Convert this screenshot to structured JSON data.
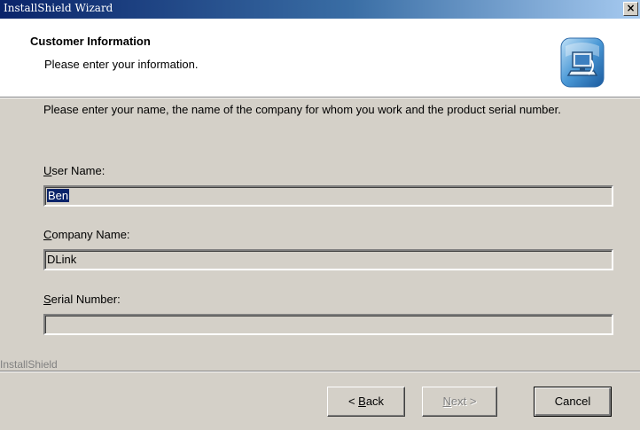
{
  "window": {
    "title": "InstallShield Wizard",
    "close_glyph": "×"
  },
  "header": {
    "title": "Customer Information",
    "subtitle": "Please enter your information.",
    "icon": "installshield-computer-icon"
  },
  "intro": "Please enter your name, the name of the company for whom you work and the product serial number.",
  "fields": {
    "user_name": {
      "label_accel": "U",
      "label_rest": "ser Name:",
      "value": "Ben",
      "selected": true
    },
    "company_name": {
      "label_accel": "C",
      "label_rest": "ompany Name:",
      "value": "DLink"
    },
    "serial_number": {
      "label_accel": "S",
      "label_rest": "erial Number:",
      "value": ""
    }
  },
  "footer": {
    "brand": "InstallShield"
  },
  "buttons": {
    "back": {
      "prefix": "< ",
      "accel": "B",
      "rest": "ack"
    },
    "next": {
      "accel": "N",
      "rest": "ext >",
      "disabled": true
    },
    "cancel": {
      "label": "Cancel"
    }
  },
  "colors": {
    "titlebar_start": "#0a246a",
    "titlebar_end": "#a6caf0",
    "face": "#d4d0c8",
    "selection": "#0a246a"
  }
}
